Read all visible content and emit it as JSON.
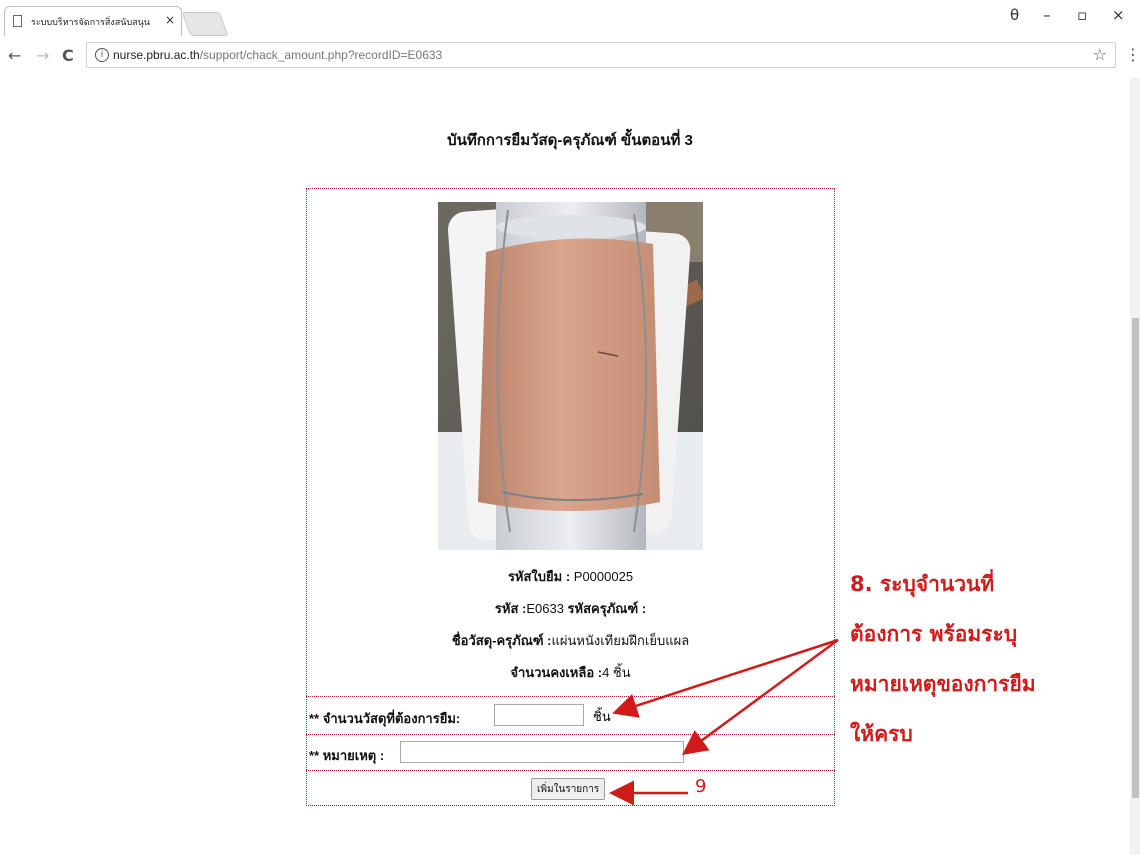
{
  "browser": {
    "tab_title": "ระบบบริหารจัดการสิ่งสนับสนุน",
    "tab_close": "×",
    "window_controls": {
      "account": "θ",
      "minimize": "–",
      "maximize": "▫",
      "close": "×"
    },
    "nav": {
      "back": "←",
      "forward": "→",
      "reload": "C"
    },
    "url_host": "nurse.pbru.ac.th",
    "url_path": "/support/chack_amount.php?recordID=E0633",
    "info_icon": "i",
    "star": "☆",
    "menu": "⋮"
  },
  "page": {
    "heading": "บันทึกการยืมวัสดุ-ครุภัณฑ์ ขั้นตอนที่ 3",
    "slip_label": "รหัสใบยืม :",
    "slip_value": " P0000025",
    "code_label": "รหัส :",
    "code_value": "E0633 ",
    "asset_code_label": "รหัสครุภัณฑ์ :",
    "name_label": "ชื่อวัสดุ-ครุภัณฑ์ :",
    "name_value": "แผ่นหนังเทียมฝึกเย็บแผล",
    "remain_label": "จำนวนคงเหลือ :",
    "remain_value": "4 ชิ้น",
    "qty_label": "** จำนวนวัสดุที่ต้องการยืม:",
    "qty_value": "",
    "qty_unit": "ชิ้น",
    "note_label": "** หมายเหตุ :",
    "note_value": "",
    "add_button": "เพิ่มในรายการ"
  },
  "annotations": {
    "step8_line1": "8. ระบุจำนวนที่",
    "step8_line2": "ต้องการ พร้อมระบุ",
    "step8_line3": "หมายเหตุของการยืม",
    "step8_line4": "ให้ครบ",
    "step9": "9",
    "color": "#d11a1a"
  }
}
